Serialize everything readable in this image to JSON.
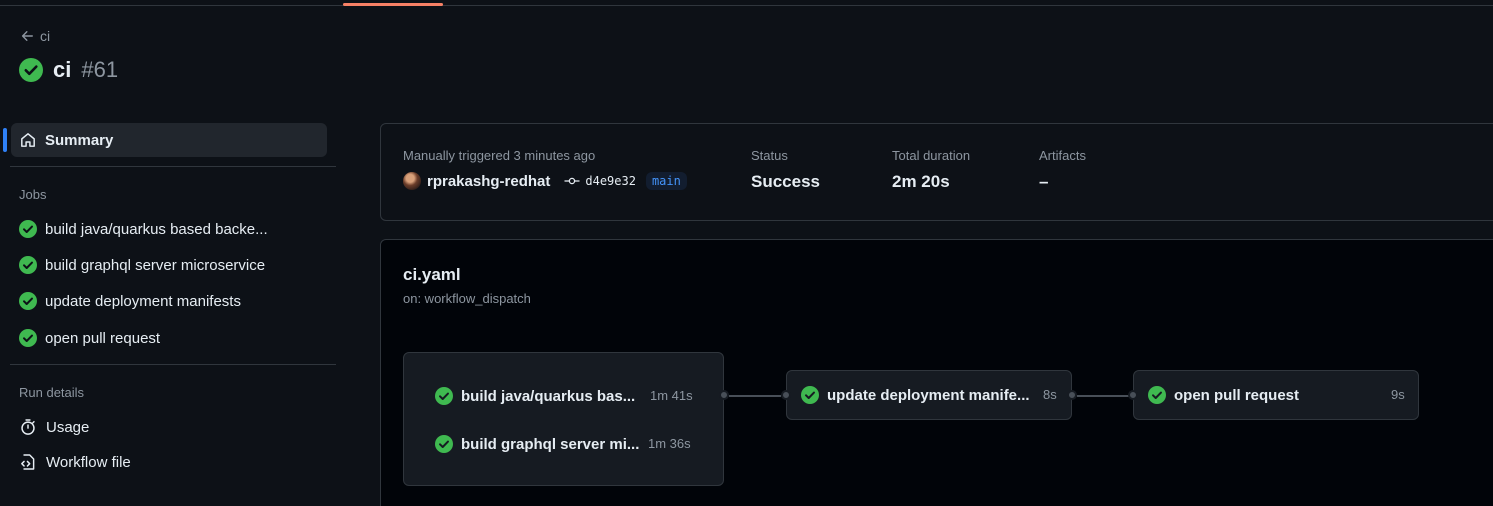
{
  "back_link": "ci",
  "run": {
    "name": "ci",
    "number": "#61",
    "status_icon": "check-circle-fill-icon"
  },
  "sidebar": {
    "summary_label": "Summary",
    "jobs_heading": "Jobs",
    "jobs": [
      {
        "label": "build java/quarkus based backe..."
      },
      {
        "label": "build graphql server microservice"
      },
      {
        "label": "update deployment manifests"
      },
      {
        "label": "open pull request"
      }
    ],
    "run_details_heading": "Run details",
    "details": [
      {
        "label": "Usage",
        "icon": "stopwatch-icon"
      },
      {
        "label": "Workflow file",
        "icon": "file-code-icon"
      }
    ]
  },
  "summary_card": {
    "trigger_label": "Manually triggered 3 minutes ago",
    "actor": "rprakashg-redhat",
    "commit_sha": "d4e9e32",
    "branch": "main",
    "status_label": "Status",
    "status_value": "Success",
    "duration_label": "Total duration",
    "duration_value": "2m 20s",
    "artifacts_label": "Artifacts",
    "artifacts_value": "–"
  },
  "workflow": {
    "file": "ci.yaml",
    "trigger": "on: workflow_dispatch",
    "nodes": [
      {
        "label": "build java/quarkus bas...",
        "duration": "1m 41s"
      },
      {
        "label": "build graphql server mi...",
        "duration": "1m 36s"
      },
      {
        "label": "update deployment manife...",
        "duration": "8s"
      },
      {
        "label": "open pull request",
        "duration": "9s"
      }
    ]
  },
  "colors": {
    "accent": "#2f81f7",
    "success": "#3fb950",
    "tab_underline": "#f78166"
  }
}
